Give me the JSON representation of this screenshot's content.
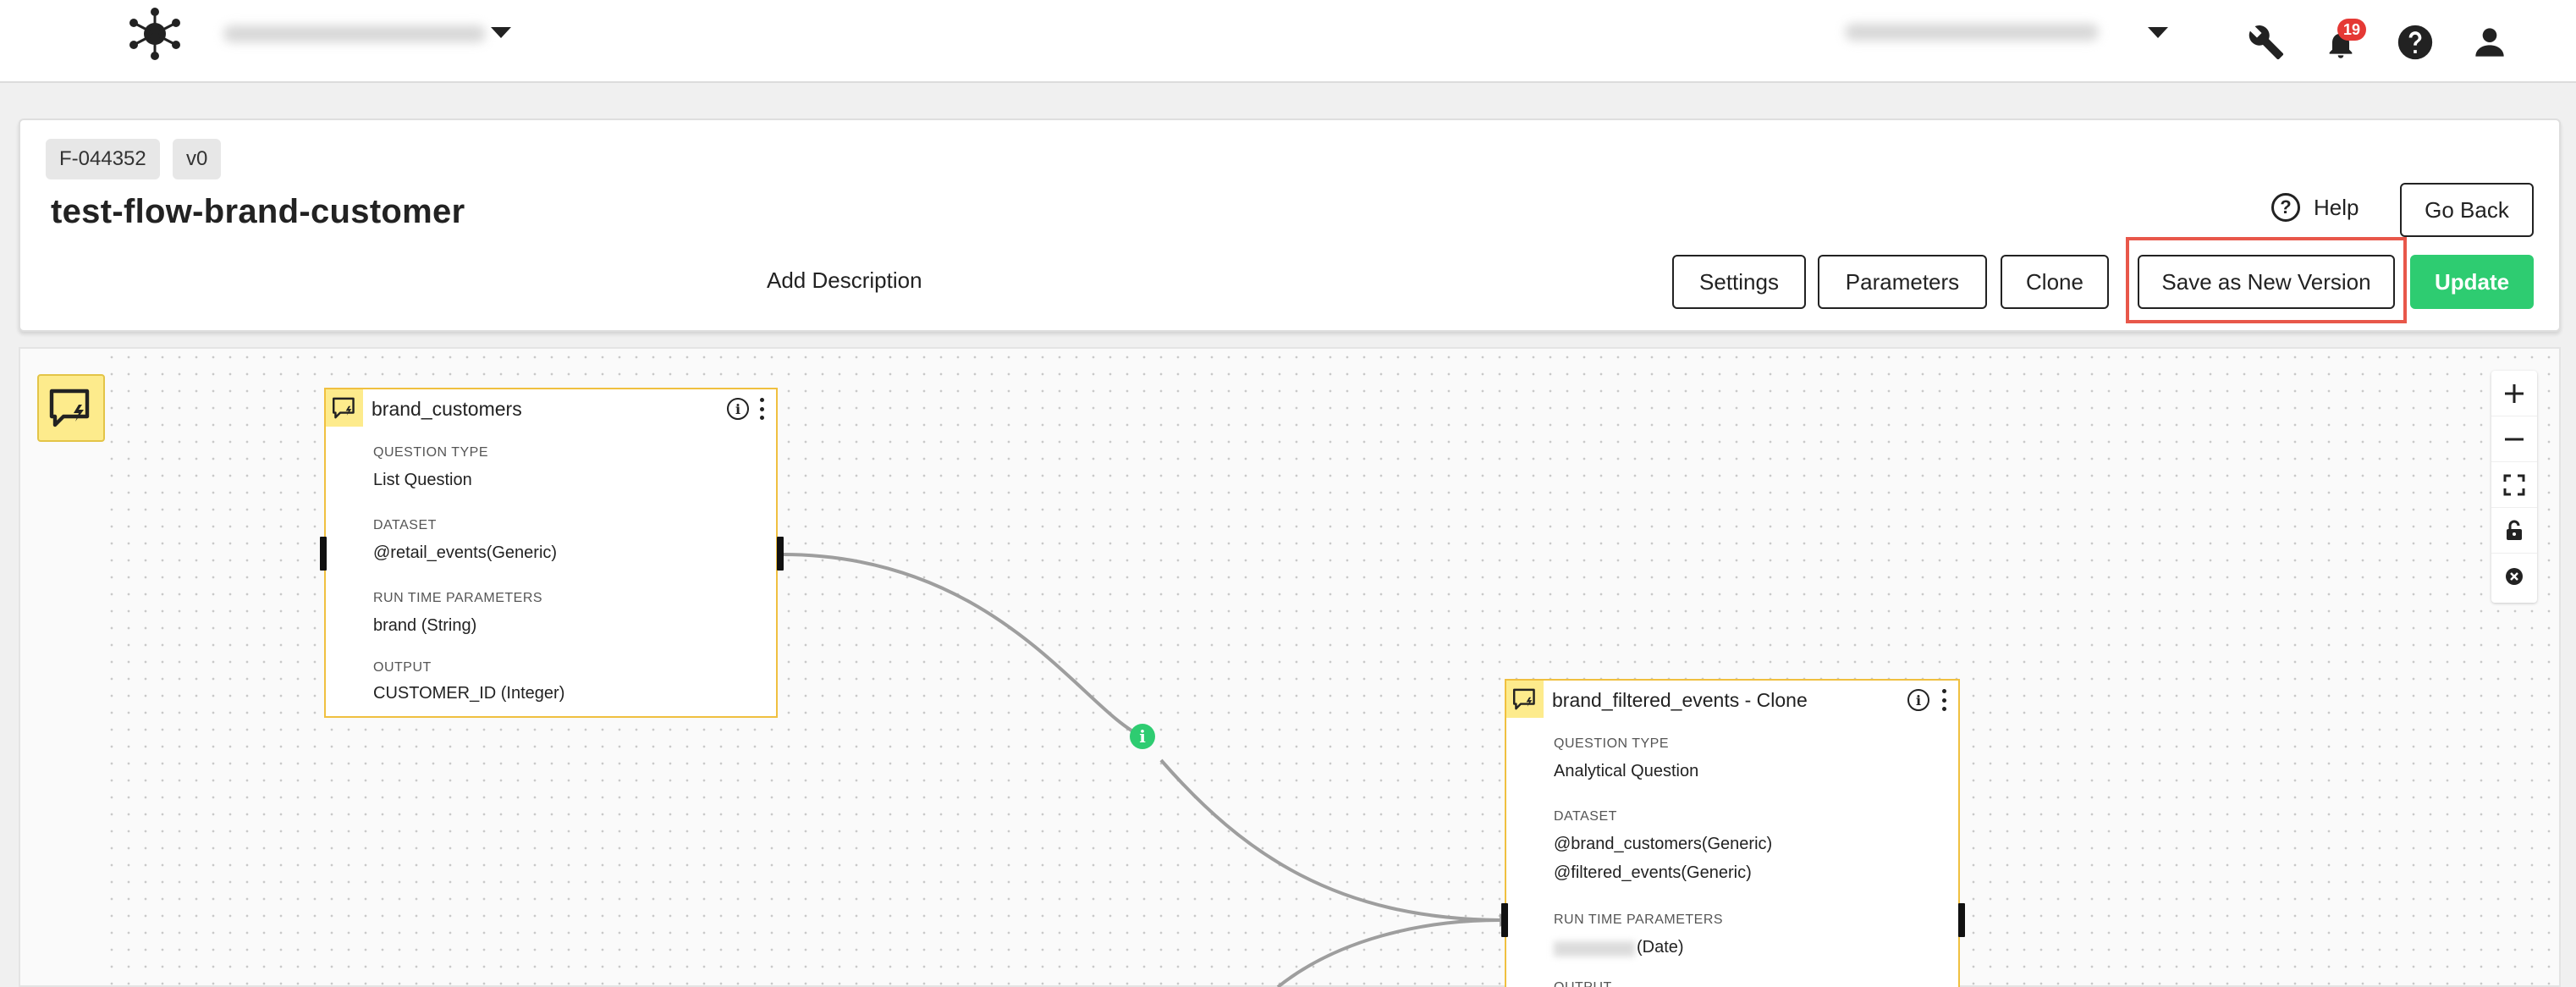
{
  "topbar": {
    "notifications_count": "19"
  },
  "flow": {
    "id_tag": "F-044352",
    "version_tag": "v0",
    "title": "test-flow-brand-customer",
    "description_prompt": "Add Description"
  },
  "actions": {
    "help": "Help",
    "go_back": "Go Back",
    "settings": "Settings",
    "parameters": "Parameters",
    "clone": "Clone",
    "save_new_version": "Save as New Version",
    "update": "Update"
  },
  "nodes": [
    {
      "title": "brand_customers",
      "question_type_label": "QUESTION TYPE",
      "question_type": "List Question",
      "dataset_label": "DATASET",
      "datasets": [
        "@retail_events(Generic)"
      ],
      "runtime_label": "RUN TIME PARAMETERS",
      "runtime_params": "brand (String)",
      "output_label": "OUTPUT",
      "output": "CUSTOMER_ID (Integer)"
    },
    {
      "title": "brand_filtered_events - Clone",
      "question_type_label": "QUESTION TYPE",
      "question_type": "Analytical Question",
      "dataset_label": "DATASET",
      "datasets": [
        "@brand_customers(Generic)",
        "@filtered_events(Generic)"
      ],
      "runtime_label": "RUN TIME PARAMETERS",
      "runtime_params": "(Date)",
      "output_label": "OUTPUT"
    }
  ],
  "colors": {
    "accent_green": "#2ecc71",
    "node_border": "#f0c040",
    "node_icon_bg": "#fdeb8c",
    "highlight": "#e8574a",
    "badge": "#e53935"
  },
  "icons": {
    "logo": "network-logo-icon",
    "tools": "wrench-icon",
    "notifications": "bell-icon",
    "help": "question-circle-icon",
    "user": "user-icon",
    "palette": "question-node-icon",
    "zoom_in": "plus-icon",
    "zoom_out": "minus-icon",
    "fit": "fit-view-icon",
    "lock": "lock-icon",
    "reset": "reset-icon",
    "edge_info": "info-icon"
  }
}
